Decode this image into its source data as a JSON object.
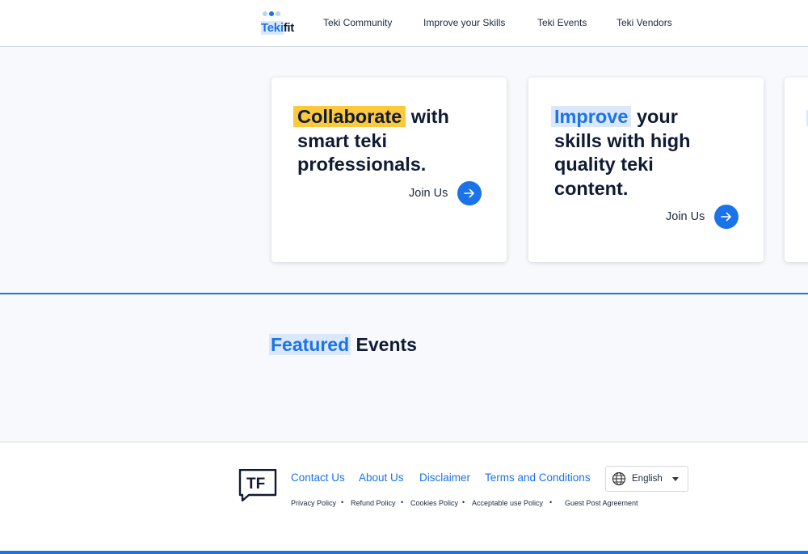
{
  "header": {
    "logo": {
      "part1": "Teki",
      "part2": "fit"
    },
    "nav": [
      "Teki Community",
      "Improve your Skills",
      "Teki Events",
      "Teki Vendors"
    ]
  },
  "cards": [
    {
      "highlight": "Collaborate",
      "rest1": " with",
      "rest2": "smart teki",
      "rest3": "professionals.",
      "cta": "Join Us"
    },
    {
      "highlight": "Improve",
      "rest1": " your",
      "rest2": "skills with high",
      "rest3": "quality teki",
      "rest4": "content.",
      "cta": "Join Us"
    }
  ],
  "featured": {
    "highlight": "Featured",
    "rest": " Events"
  },
  "footer": {
    "logo_text": "TF",
    "links": [
      "Contact Us",
      "About Us",
      "Disclaimer",
      "Terms and Conditions"
    ],
    "language": "English",
    "policies": [
      "Privacy Policy",
      "Refund Policy",
      "Cookies Policy",
      "Acceptable use Policy",
      "Guest Post Agreement"
    ]
  },
  "colors": {
    "accent": "#1a73e8",
    "highlight_yellow": "#fcc93c",
    "highlight_blue_bg": "#dbe8fb",
    "text_dark": "#0f1b33"
  },
  "icons": [
    "arrow-right-icon",
    "globe-icon",
    "caret-down-icon"
  ]
}
